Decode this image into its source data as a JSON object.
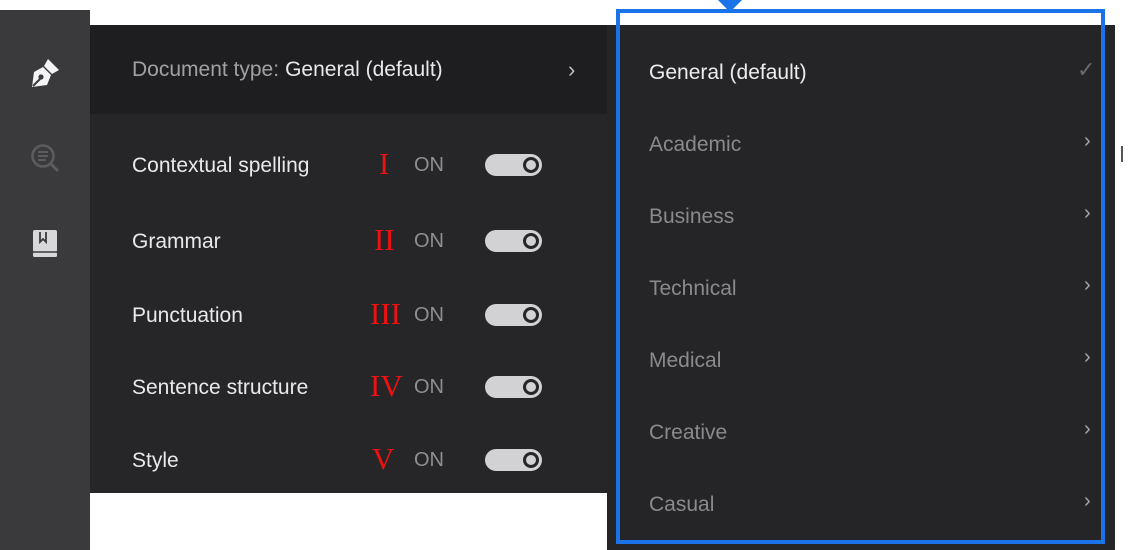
{
  "sidebar": {
    "icons": [
      "pen-nib-icon",
      "search-document-icon",
      "bookmark-book-icon"
    ]
  },
  "document_type": {
    "label": "Document type:",
    "value": "General (default)",
    "chevron": "›"
  },
  "settings": [
    {
      "label": "Contextual spelling",
      "numeral": "I",
      "state": "ON"
    },
    {
      "label": "Grammar",
      "numeral": "II",
      "state": "ON"
    },
    {
      "label": "Punctuation",
      "numeral": "III",
      "state": "ON"
    },
    {
      "label": "Sentence structure",
      "numeral": "IV",
      "state": "ON"
    },
    {
      "label": "Style",
      "numeral": "V",
      "state": "ON"
    }
  ],
  "menu": {
    "check": "✓",
    "chevron": "›",
    "items": [
      {
        "label": "General (default)",
        "selected": true
      },
      {
        "label": "Academic",
        "selected": false
      },
      {
        "label": "Business",
        "selected": false
      },
      {
        "label": "Technical",
        "selected": false
      },
      {
        "label": "Medical",
        "selected": false
      },
      {
        "label": "Creative",
        "selected": false
      },
      {
        "label": "Casual",
        "selected": false
      }
    ]
  },
  "colors": {
    "highlight": "#1a73e8",
    "numerals": "#ee1111",
    "panel_bg": "#262629",
    "rail_bg": "#3a3a3d"
  }
}
